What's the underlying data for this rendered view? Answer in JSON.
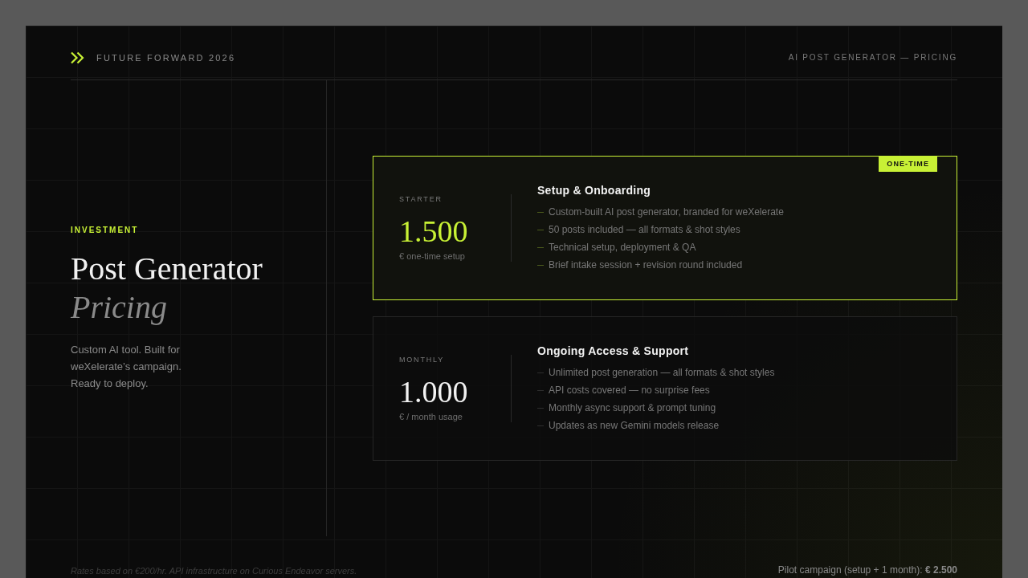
{
  "header": {
    "brand": "FUTURE FORWARD 2026",
    "page_label": "AI POST GENERATOR — PRICING"
  },
  "intro": {
    "eyebrow": "INVESTMENT",
    "title": "Post Generator",
    "title_accent": "Pricing",
    "description": "Custom AI tool. Built for weXelerate’s campaign. Ready to deploy."
  },
  "plans": [
    {
      "tier": "STARTER",
      "price": "1.500",
      "price_note": "€ one-time setup",
      "title": "Setup & Onboarding",
      "featured": true,
      "badge": "ONE-TIME",
      "features": [
        "Custom-built AI post generator, branded for weXelerate",
        "50 posts included — all formats & shot styles",
        "Technical setup, deployment & QA",
        "Brief intake session + revision round included"
      ]
    },
    {
      "tier": "MONTHLY",
      "price": "1.000",
      "price_note": "€ / month usage",
      "title": "Ongoing Access & Support",
      "featured": false,
      "features": [
        "Unlimited post generation — all formats & shot styles",
        "API costs covered — no surprise fees",
        "Monthly async support & prompt tuning",
        "Updates as new Gemini models release"
      ]
    }
  ],
  "footer": {
    "note": "Rates based on €200/hr. API infrastructure on Curious Endeavor servers.",
    "total": "Pilot campaign (setup + 1 month): **€ 2.500**"
  }
}
